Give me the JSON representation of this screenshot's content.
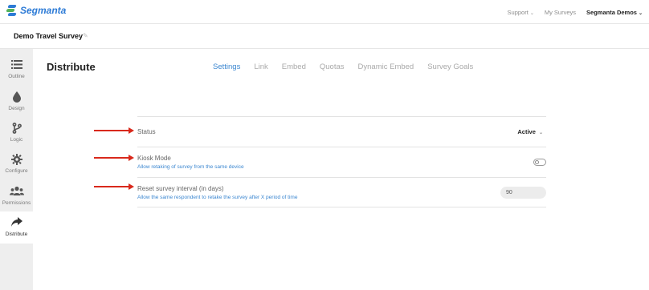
{
  "brand": {
    "name": "Segmanta"
  },
  "topnav": {
    "support": "Support",
    "my_surveys": "My Surveys",
    "account": "Segmanta Demos"
  },
  "survey": {
    "title": "Demo Travel Survey"
  },
  "sidebar": {
    "items": [
      {
        "label": "Outline",
        "icon": "list-icon"
      },
      {
        "label": "Design",
        "icon": "droplet-icon"
      },
      {
        "label": "Logic",
        "icon": "branch-icon"
      },
      {
        "label": "Configure",
        "icon": "gear-icon"
      },
      {
        "label": "Permissions",
        "icon": "people-icon"
      },
      {
        "label": "Distribute",
        "icon": "share-arrow-icon",
        "active": true
      }
    ]
  },
  "main": {
    "title": "Distribute",
    "tabs": [
      {
        "label": "Settings",
        "active": true
      },
      {
        "label": "Link"
      },
      {
        "label": "Embed"
      },
      {
        "label": "Quotas"
      },
      {
        "label": "Dynamic Embed"
      },
      {
        "label": "Survey Goals"
      }
    ]
  },
  "settings": {
    "status": {
      "label": "Status",
      "value": "Active"
    },
    "kiosk": {
      "label": "Kiosk Mode",
      "description": "Allow retaking of survey from the same device",
      "enabled": false
    },
    "reset": {
      "label": "Reset survey interval (in days)",
      "description": "Allow the same respondent to retake the survey after X period of time",
      "value": "90"
    }
  },
  "colors": {
    "accent": "#3a86d0",
    "annotation_arrow": "#d9291c",
    "sidebar_bg": "#eeeeee"
  }
}
